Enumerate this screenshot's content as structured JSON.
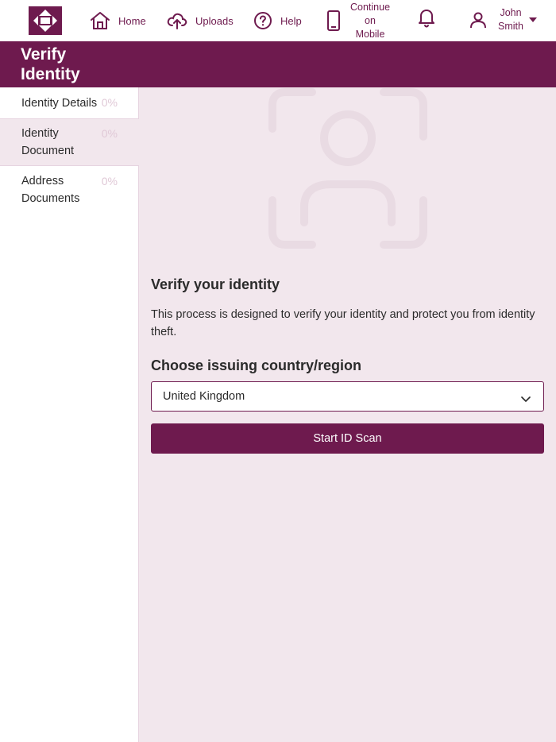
{
  "nav": {
    "home_label": "Home",
    "uploads_label": "Uploads",
    "help_label": "Help",
    "mobile_label": "Continue on Mobile",
    "user_name": "John Smith",
    "icons": [
      "logo-icon",
      "home-icon",
      "upload-icon",
      "help-icon",
      "mobile-icon",
      "bell-icon",
      "user-icon",
      "caret-down-icon"
    ]
  },
  "header": {
    "title": "Verify Identity"
  },
  "sidebar": {
    "steps": [
      {
        "label": "Identity Details",
        "progress": "0%"
      },
      {
        "label": "Identity Document",
        "progress": "0%"
      },
      {
        "label": "Address Documents",
        "progress": "0%"
      }
    ]
  },
  "main": {
    "heading": "Verify your identity",
    "description": "This process is designed to verify your identity and protect you from identity theft.",
    "country_heading": "Choose issuing country/region",
    "country_value": "United Kingdom",
    "start_button": "Start ID Scan"
  },
  "colors": {
    "brand": "#6e1a4e",
    "panel_bg": "#f2e7ed",
    "progress_text": "#e0c9d7"
  }
}
